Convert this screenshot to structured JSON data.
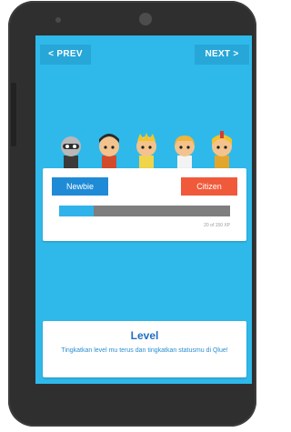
{
  "nav": {
    "prev_label": "< PREV",
    "next_label": "NEXT >"
  },
  "avatars": [
    {
      "name": "avatar-character-1"
    },
    {
      "name": "avatar-character-2"
    },
    {
      "name": "avatar-character-3"
    },
    {
      "name": "avatar-character-4"
    },
    {
      "name": "avatar-character-5"
    }
  ],
  "level_card": {
    "left_badge": "Newbie",
    "right_badge": "Citizen",
    "progress_fraction": 0.2,
    "xp_text": "20 of 150 XP"
  },
  "info_card": {
    "title": "Level",
    "description": "Tingkatkan level mu terus dan tingkatkan statusmu di Qlue!"
  },
  "colors": {
    "screen_bg": "#2fb9ea",
    "nav_button": "#27a7d8",
    "newbie_badge": "#1f8bd6",
    "citizen_badge": "#f05a3b",
    "progress_fill": "#2fb3ea",
    "progress_track": "#7e7e7e",
    "title_text": "#1f6fc2"
  }
}
